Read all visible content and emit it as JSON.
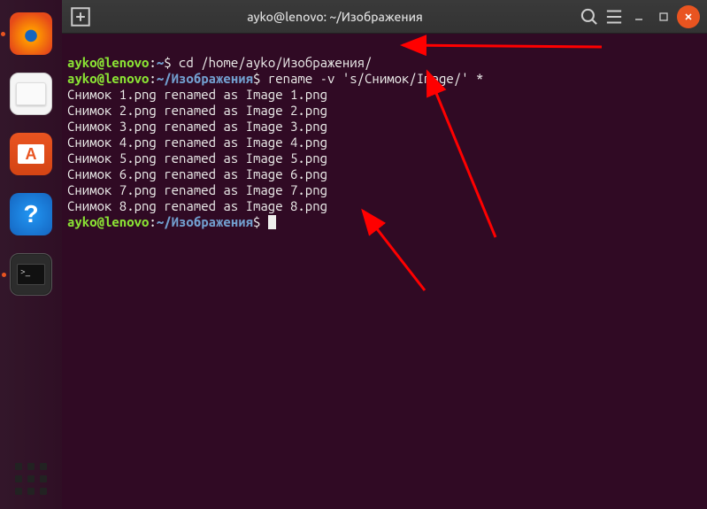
{
  "titlebar": {
    "title": "ayko@lenovo: ~/Изображения"
  },
  "dock": {
    "firefox": "Firefox",
    "files": "Files",
    "software": "A",
    "help": "?",
    "terminal_prompt": ">_"
  },
  "terminal": {
    "prompt1_user": "ayko@lenovo",
    "prompt1_sep": ":",
    "prompt1_path": "~",
    "prompt1_dollar": "$",
    "cmd1": " cd /home/ayko/Изображения/",
    "prompt2_user": "ayko@lenovo",
    "prompt2_sep": ":",
    "prompt2_path": "~/Изображения",
    "prompt2_dollar": "$",
    "cmd2": " rename -v 's/Снимок/Image/' *",
    "out1": "Снимок 1.png renamed as Image 1.png",
    "out2": "Снимок 2.png renamed as Image 2.png",
    "out3": "Снимок 3.png renamed as Image 3.png",
    "out4": "Снимок 4.png renamed as Image 4.png",
    "out5": "Снимок 5.png renamed as Image 5.png",
    "out6": "Снимок 6.png renamed as Image 6.png",
    "out7": "Снимок 7.png renamed as Image 7.png",
    "out8": "Снимок 8.png renamed as Image 8.png",
    "prompt3_user": "ayko@lenovo",
    "prompt3_sep": ":",
    "prompt3_path": "~/Изображения",
    "prompt3_dollar": "$",
    "cmd3": " "
  },
  "annotations": {
    "arrow_color": "#ff0000"
  }
}
